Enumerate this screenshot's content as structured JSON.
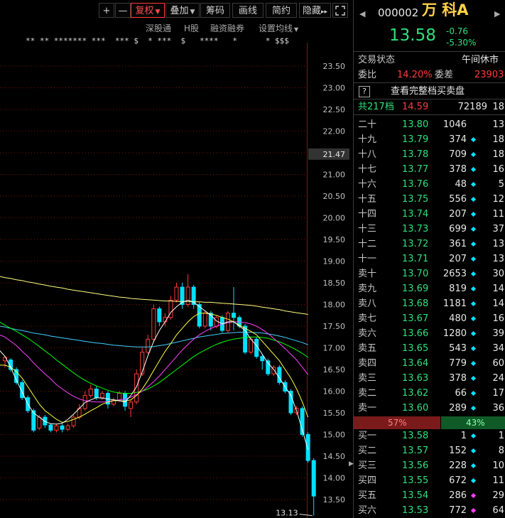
{
  "toolbar": {
    "plus": "+",
    "minus": "—",
    "fuquan": "复权",
    "diejia": "叠加",
    "chouma": "筹码",
    "huaxian": "画线",
    "jianyue": "简约",
    "yincang": "隐藏",
    "yincang_arrows": "▸▸",
    "fullscreen_icon": "expand-icon"
  },
  "subbar": {
    "shengutong": "深股通",
    "hgu": "H股",
    "rongzi": "融资融券",
    "shezhi": "设置均线"
  },
  "star_row": "** ** ******* ***  *** $  * ***  $   ****   *      * $$$",
  "price_axis": [
    "23.50",
    "23.00",
    "22.50",
    "22.00",
    "21.50",
    "21.00",
    "20.50",
    "20.00",
    "19.50",
    "19.00",
    "18.50",
    "18.00",
    "17.50",
    "17.00",
    "16.50",
    "16.00",
    "15.50",
    "15.00",
    "14.50",
    "14.00",
    "13.50"
  ],
  "cursor_label": "21.47",
  "low_label": "13.13",
  "colors": {
    "up": "#ff3b3b",
    "down": "#00e0ff",
    "ma5": "#ffffff",
    "ma10": "#ffff40",
    "ma20": "#ff40ff",
    "ma30": "#00ff00",
    "ma60": "#40d0ff",
    "ma120": "#ffff80"
  },
  "stock": {
    "code": "000002",
    "name": "万 科A",
    "price": "13.58",
    "change": "-0.76",
    "change_pct": "-5.30%",
    "trade_status_label": "交易状态",
    "trade_status": "午间休市",
    "weibi_label": "委比",
    "weibi": "14.20%",
    "weicha_label": "委差",
    "weicha": "23903",
    "full_book_icon": "?",
    "full_book": "查看完整档买卖盘",
    "total_label": "共217档",
    "total_price": "14.59",
    "total_vol": "72189",
    "total_count": "18"
  },
  "asks": [
    {
      "label": "二十",
      "price": "13.80",
      "vol": "1046",
      "dot": "",
      "count": "13"
    },
    {
      "label": "十九",
      "price": "13.79",
      "vol": "374",
      "dot": "cyan",
      "count": "18"
    },
    {
      "label": "十八",
      "price": "13.78",
      "vol": "709",
      "dot": "cyan",
      "count": "18"
    },
    {
      "label": "十七",
      "price": "13.77",
      "vol": "378",
      "dot": "cyan",
      "count": "16"
    },
    {
      "label": "十六",
      "price": "13.76",
      "vol": "48",
      "dot": "cyan",
      "count": "5"
    },
    {
      "label": "十五",
      "price": "13.75",
      "vol": "556",
      "dot": "cyan",
      "count": "12"
    },
    {
      "label": "十四",
      "price": "13.74",
      "vol": "207",
      "dot": "cyan",
      "count": "11"
    },
    {
      "label": "十三",
      "price": "13.73",
      "vol": "699",
      "dot": "cyan",
      "count": "37"
    },
    {
      "label": "十二",
      "price": "13.72",
      "vol": "361",
      "dot": "cyan",
      "count": "13"
    },
    {
      "label": "十一",
      "price": "13.71",
      "vol": "207",
      "dot": "cyan",
      "count": "13"
    },
    {
      "label": "卖十",
      "price": "13.70",
      "vol": "2653",
      "dot": "cyan",
      "count": "30"
    },
    {
      "label": "卖九",
      "price": "13.69",
      "vol": "819",
      "dot": "cyan",
      "count": "14"
    },
    {
      "label": "卖八",
      "price": "13.68",
      "vol": "1181",
      "dot": "cyan",
      "count": "14"
    },
    {
      "label": "卖七",
      "price": "13.67",
      "vol": "480",
      "dot": "cyan",
      "count": "16"
    },
    {
      "label": "卖六",
      "price": "13.66",
      "vol": "1280",
      "dot": "cyan",
      "count": "39"
    },
    {
      "label": "卖五",
      "price": "13.65",
      "vol": "543",
      "dot": "cyan",
      "count": "34"
    },
    {
      "label": "卖四",
      "price": "13.64",
      "vol": "779",
      "dot": "cyan",
      "count": "60"
    },
    {
      "label": "卖三",
      "price": "13.63",
      "vol": "378",
      "dot": "cyan",
      "count": "24"
    },
    {
      "label": "卖二",
      "price": "13.62",
      "vol": "66",
      "dot": "cyan",
      "count": "17"
    },
    {
      "label": "卖一",
      "price": "13.60",
      "vol": "289",
      "dot": "cyan",
      "count": "36"
    }
  ],
  "ratio": {
    "sell": "57%",
    "buy": "43%",
    "sell_frac": 0.57
  },
  "bids": [
    {
      "label": "买一",
      "price": "13.58",
      "vol": "1",
      "dot": "cyan",
      "count": "1"
    },
    {
      "label": "买二",
      "price": "13.57",
      "vol": "152",
      "dot": "cyan",
      "count": "8"
    },
    {
      "label": "买三",
      "price": "13.56",
      "vol": "228",
      "dot": "cyan",
      "count": "10"
    },
    {
      "label": "买四",
      "price": "13.55",
      "vol": "672",
      "dot": "cyan",
      "count": "11"
    },
    {
      "label": "买五",
      "price": "13.54",
      "vol": "286",
      "dot": "magenta",
      "count": "29"
    },
    {
      "label": "买六",
      "price": "13.53",
      "vol": "772",
      "dot": "magenta",
      "count": "64"
    }
  ],
  "chart_data": {
    "type": "candlestick",
    "ylim": [
      13.0,
      23.7
    ],
    "candles": [
      [
        16.7,
        16.78,
        16.55,
        16.8
      ],
      [
        16.72,
        16.5,
        16.45,
        16.76
      ],
      [
        16.5,
        16.2,
        16.15,
        16.55
      ],
      [
        16.2,
        15.85,
        15.8,
        16.25
      ],
      [
        15.85,
        15.55,
        15.5,
        15.9
      ],
      [
        15.55,
        15.1,
        15.05,
        15.6
      ],
      [
        15.15,
        15.4,
        15.1,
        15.45
      ],
      [
        15.4,
        15.22,
        15.15,
        15.45
      ],
      [
        15.22,
        15.1,
        15.05,
        15.25
      ],
      [
        15.1,
        15.2,
        15.05,
        15.25
      ],
      [
        15.2,
        15.12,
        15.05,
        15.24
      ],
      [
        15.12,
        15.2,
        15.08,
        15.25
      ],
      [
        15.2,
        15.4,
        15.15,
        15.45
      ],
      [
        15.4,
        15.6,
        15.35,
        15.7
      ],
      [
        15.6,
        15.9,
        15.55,
        16.0
      ],
      [
        15.9,
        16.05,
        15.85,
        16.15
      ],
      [
        16.05,
        15.85,
        15.8,
        16.12
      ],
      [
        15.85,
        15.95,
        15.8,
        16.0
      ],
      [
        15.95,
        15.7,
        15.6,
        16.0
      ],
      [
        15.7,
        15.8,
        15.65,
        15.85
      ],
      [
        15.8,
        15.95,
        15.75,
        16.0
      ],
      [
        15.95,
        15.65,
        15.55,
        16.0
      ],
      [
        15.6,
        15.75,
        15.4,
        15.8
      ],
      [
        15.75,
        16.4,
        15.7,
        16.5
      ],
      [
        16.4,
        16.9,
        16.35,
        17.0
      ],
      [
        16.9,
        17.2,
        16.85,
        17.3
      ],
      [
        17.2,
        17.9,
        17.15,
        18.0
      ],
      [
        17.9,
        17.6,
        17.5,
        17.95
      ],
      [
        17.6,
        17.7,
        17.5,
        17.8
      ],
      [
        17.7,
        18.1,
        17.65,
        18.2
      ],
      [
        18.1,
        18.4,
        18.05,
        18.5
      ],
      [
        18.4,
        18.0,
        17.9,
        18.5
      ],
      [
        18.0,
        18.4,
        17.95,
        18.7
      ],
      [
        18.4,
        18.0,
        17.9,
        18.45
      ],
      [
        18.0,
        17.5,
        17.45,
        18.05
      ],
      [
        17.5,
        17.8,
        17.45,
        17.85
      ],
      [
        17.8,
        17.5,
        17.4,
        17.85
      ],
      [
        17.5,
        17.7,
        17.45,
        17.75
      ],
      [
        17.7,
        17.4,
        17.35,
        17.75
      ],
      [
        17.4,
        17.8,
        17.35,
        17.85
      ],
      [
        17.8,
        17.7,
        17.4,
        18.4
      ],
      [
        17.7,
        17.5,
        17.45,
        17.75
      ],
      [
        17.5,
        16.9,
        16.85,
        17.55
      ],
      [
        16.9,
        17.2,
        16.85,
        17.25
      ],
      [
        17.2,
        16.8,
        16.75,
        17.25
      ],
      [
        16.8,
        16.7,
        16.5,
        16.85
      ],
      [
        16.7,
        16.4,
        16.35,
        16.75
      ],
      [
        16.4,
        16.55,
        16.35,
        16.6
      ],
      [
        16.55,
        16.2,
        16.15,
        16.6
      ],
      [
        16.2,
        16.0,
        15.95,
        16.25
      ],
      [
        16.0,
        15.5,
        15.45,
        16.05
      ],
      [
        15.5,
        15.6,
        15.45,
        15.65
      ],
      [
        15.6,
        15.0,
        14.95,
        15.65
      ],
      [
        15.0,
        14.4,
        14.35,
        15.05
      ],
      [
        14.4,
        13.58,
        13.13,
        14.45
      ]
    ],
    "ma5": [
      16.95,
      16.8,
      16.55,
      16.25,
      15.98,
      15.7,
      15.5,
      15.4,
      15.3,
      15.25,
      15.24,
      15.26,
      15.35,
      15.47,
      15.6,
      15.74,
      15.8,
      15.85,
      15.84,
      15.82,
      15.8,
      15.78,
      15.75,
      15.9,
      16.1,
      16.45,
      16.82,
      17.15,
      17.4,
      17.6,
      17.82,
      17.95,
      18.05,
      18.1,
      18.05,
      17.95,
      17.85,
      17.75,
      17.62,
      17.55,
      17.6,
      17.6,
      17.5,
      17.4,
      17.2,
      17.05,
      16.85,
      16.65,
      16.5,
      16.3,
      16.1,
      15.9,
      15.55,
      15.1,
      14.65
    ],
    "ma10": [
      16.6,
      16.6,
      16.55,
      16.45,
      16.3,
      16.1,
      15.9,
      15.7,
      15.55,
      15.45,
      15.35,
      15.28,
      15.3,
      15.35,
      15.4,
      15.47,
      15.55,
      15.62,
      15.7,
      15.75,
      15.78,
      15.78,
      15.77,
      15.8,
      15.9,
      16.05,
      16.25,
      16.48,
      16.7,
      16.92,
      17.1,
      17.3,
      17.45,
      17.6,
      17.72,
      17.8,
      17.8,
      17.78,
      17.75,
      17.7,
      17.66,
      17.6,
      17.52,
      17.45,
      17.38,
      17.3,
      17.15,
      17.0,
      16.85,
      16.7,
      16.5,
      16.3,
      16.05,
      15.75,
      15.4
    ],
    "ma20": [
      17.3,
      17.25,
      17.15,
      17.05,
      16.92,
      16.8,
      16.65,
      16.52,
      16.4,
      16.28,
      16.15,
      16.05,
      15.96,
      15.88,
      15.82,
      15.78,
      15.76,
      15.75,
      15.75,
      15.76,
      15.78,
      15.8,
      15.82,
      15.86,
      15.92,
      16.0,
      16.1,
      16.22,
      16.35,
      16.5,
      16.65,
      16.8,
      16.95,
      17.08,
      17.2,
      17.3,
      17.38,
      17.45,
      17.5,
      17.55,
      17.58,
      17.6,
      17.6,
      17.58,
      17.55,
      17.5,
      17.42,
      17.33,
      17.22,
      17.1,
      16.98,
      16.85,
      16.72,
      16.55,
      16.38
    ],
    "ma30": [
      17.6,
      17.52,
      17.45,
      17.38,
      17.3,
      17.22,
      17.13,
      17.03,
      16.93,
      16.83,
      16.72,
      16.62,
      16.52,
      16.42,
      16.33,
      16.25,
      16.18,
      16.12,
      16.07,
      16.02,
      15.98,
      15.96,
      15.95,
      15.95,
      15.97,
      16.0,
      16.05,
      16.12,
      16.2,
      16.3,
      16.4,
      16.5,
      16.6,
      16.7,
      16.8,
      16.88,
      16.95,
      17.02,
      17.08,
      17.13,
      17.17,
      17.2,
      17.22,
      17.24,
      17.25,
      17.25,
      17.24,
      17.22,
      17.18,
      17.14,
      17.08,
      17.02,
      16.95,
      16.87,
      16.78
    ],
    "ma60": [
      17.5,
      17.48,
      17.45,
      17.42,
      17.4,
      17.37,
      17.34,
      17.32,
      17.3,
      17.27,
      17.25,
      17.23,
      17.21,
      17.19,
      17.17,
      17.15,
      17.13,
      17.11,
      17.1,
      17.08,
      17.06,
      17.05,
      17.04,
      17.03,
      17.02,
      17.02,
      17.02,
      17.03,
      17.05,
      17.07,
      17.1,
      17.13,
      17.16,
      17.19,
      17.22,
      17.25,
      17.27,
      17.29,
      17.31,
      17.33,
      17.34,
      17.35,
      17.36,
      17.36,
      17.36,
      17.35,
      17.34,
      17.32,
      17.3,
      17.27,
      17.24,
      17.2,
      17.16,
      17.12,
      17.07
    ],
    "ma120": [
      18.65,
      18.62,
      18.6,
      18.57,
      18.55,
      18.52,
      18.5,
      18.47,
      18.45,
      18.42,
      18.4,
      18.38,
      18.35,
      18.33,
      18.31,
      18.29,
      18.27,
      18.25,
      18.23,
      18.21,
      18.19,
      18.17,
      18.16,
      18.14,
      18.13,
      18.12,
      18.11,
      18.1,
      18.09,
      18.08,
      18.08,
      18.07,
      18.07,
      18.07,
      18.06,
      18.06,
      18.05,
      18.05,
      18.04,
      18.03,
      18.02,
      18.01,
      18.0,
      17.99,
      17.98,
      17.96,
      17.94,
      17.92,
      17.9,
      17.88,
      17.85,
      17.83,
      17.81,
      17.79,
      17.77
    ]
  }
}
